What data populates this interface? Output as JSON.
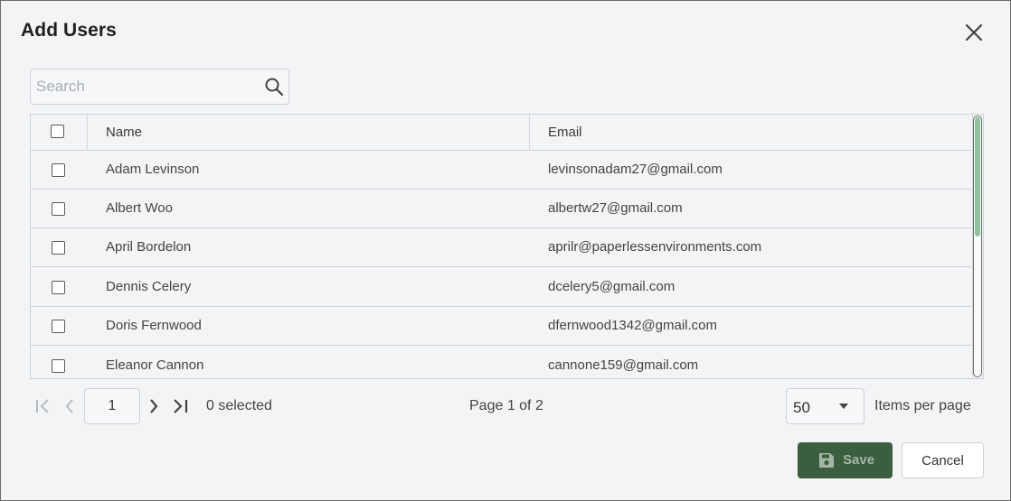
{
  "dialog": {
    "title": "Add Users",
    "close_icon": "close-icon"
  },
  "search": {
    "placeholder": "Search",
    "value": "",
    "icon": "search-icon"
  },
  "table": {
    "columns": [
      "Name",
      "Email"
    ],
    "rows": [
      {
        "name": "Adam Levinson",
        "email": "levinsonadam27@gmail.com",
        "checked": false
      },
      {
        "name": "Albert Woo",
        "email": "albertw27@gmail.com",
        "checked": false
      },
      {
        "name": "April Bordelon",
        "email": "aprilr@paperlessenvironments.com",
        "checked": false
      },
      {
        "name": "Dennis Celery",
        "email": "dcelery5@gmail.com",
        "checked": false
      },
      {
        "name": "Doris Fernwood",
        "email": "dfernwood1342@gmail.com",
        "checked": false
      },
      {
        "name": "Eleanor Cannon",
        "email": "cannone159@gmail.com",
        "checked": false
      }
    ],
    "scroll_position": 0
  },
  "pager": {
    "current_page": "1",
    "selected_text": "0 selected",
    "page_info": "Page 1 of 2",
    "items_per_page": "50",
    "items_per_page_label": "Items per page"
  },
  "actions": {
    "save_label": "Save",
    "cancel_label": "Cancel"
  },
  "colors": {
    "save_button": "#3b5e3f",
    "scroll_thumb": "#8fc39b",
    "background": "#f3f4f6"
  }
}
